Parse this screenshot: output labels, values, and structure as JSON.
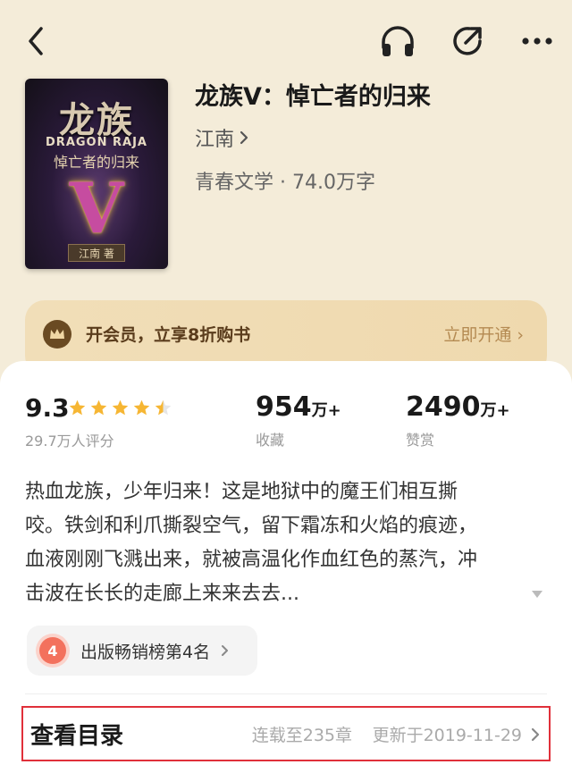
{
  "book": {
    "title": "龙族V：悼亡者的归来",
    "author": "江南",
    "meta": "青春文学 · 74.0万字",
    "cover": {
      "title": "龙族",
      "en": "DRAGON RAJA",
      "subtitle": "悼亡者的归来",
      "numeral": "V",
      "author": "江南 著"
    }
  },
  "icons": {
    "back": "back-chevron-icon",
    "listen": "headphones-icon",
    "share": "share-icon",
    "more": "more-dots-icon"
  },
  "vip": {
    "text": "开会员，立享8折购书",
    "button": "立即开通 ›"
  },
  "stats": {
    "rating": "9.3",
    "rating_stars": 4.5,
    "rating_label": "29.7万人评分",
    "collect_num": "954",
    "collect_unit": "万+",
    "collect_label": "收藏",
    "reward_num": "2490",
    "reward_unit": "万+",
    "reward_label": "赞赏"
  },
  "intro": {
    "lines": [
      "热血龙族，少年归来！这是地狱中的魔王们相互撕",
      "咬。铁剑和利爪撕裂空气，留下霜冻和火焰的痕迹，",
      "血液刚刚飞溅出来，就被高温化作血红色的蒸汽，冲",
      "击波在长长的走廊上来来去去..."
    ]
  },
  "rank": {
    "badge": "4",
    "text": "出版畅销榜第4名"
  },
  "toc": {
    "title": "查看目录",
    "serial": "连载至235章",
    "update": "更新于2019-11-29"
  },
  "colors": {
    "background": "#f4ecd9",
    "star": "#f6b633",
    "highlight_border": "#e0303a",
    "rank_badge": "#f3715d",
    "vip_text": "#5a3c1c"
  }
}
